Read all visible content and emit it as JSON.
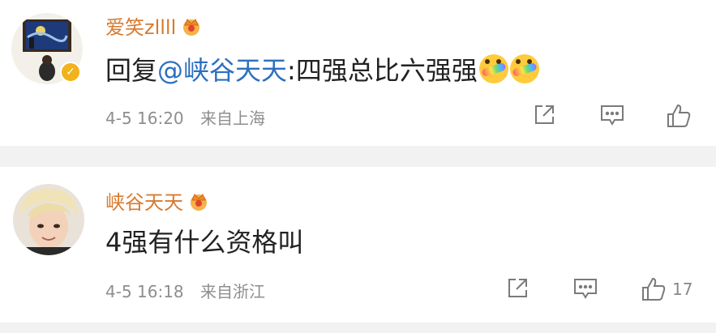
{
  "comments": [
    {
      "username": "爱笑zllll",
      "reply_prefix": "回复",
      "mention": "@峡谷天天",
      "text": ":四强总比六强强",
      "time": "4-5 16:20",
      "location": "来自上海",
      "like_count": ""
    },
    {
      "username": "峡谷天天",
      "text": "4强有什么资格叫",
      "time": "4-5 16:18",
      "location": "来自浙江",
      "like_count": "17"
    }
  ],
  "colors": {
    "username": "#d87a2e",
    "mention": "#2c6fbf",
    "meta": "#8e8e8e",
    "separator": "#f2f2f2"
  },
  "icons": [
    "crown-badge-icon",
    "verified-badge-icon",
    "share-icon",
    "comment-icon",
    "like-icon",
    "rainbow-emoji-icon"
  ]
}
